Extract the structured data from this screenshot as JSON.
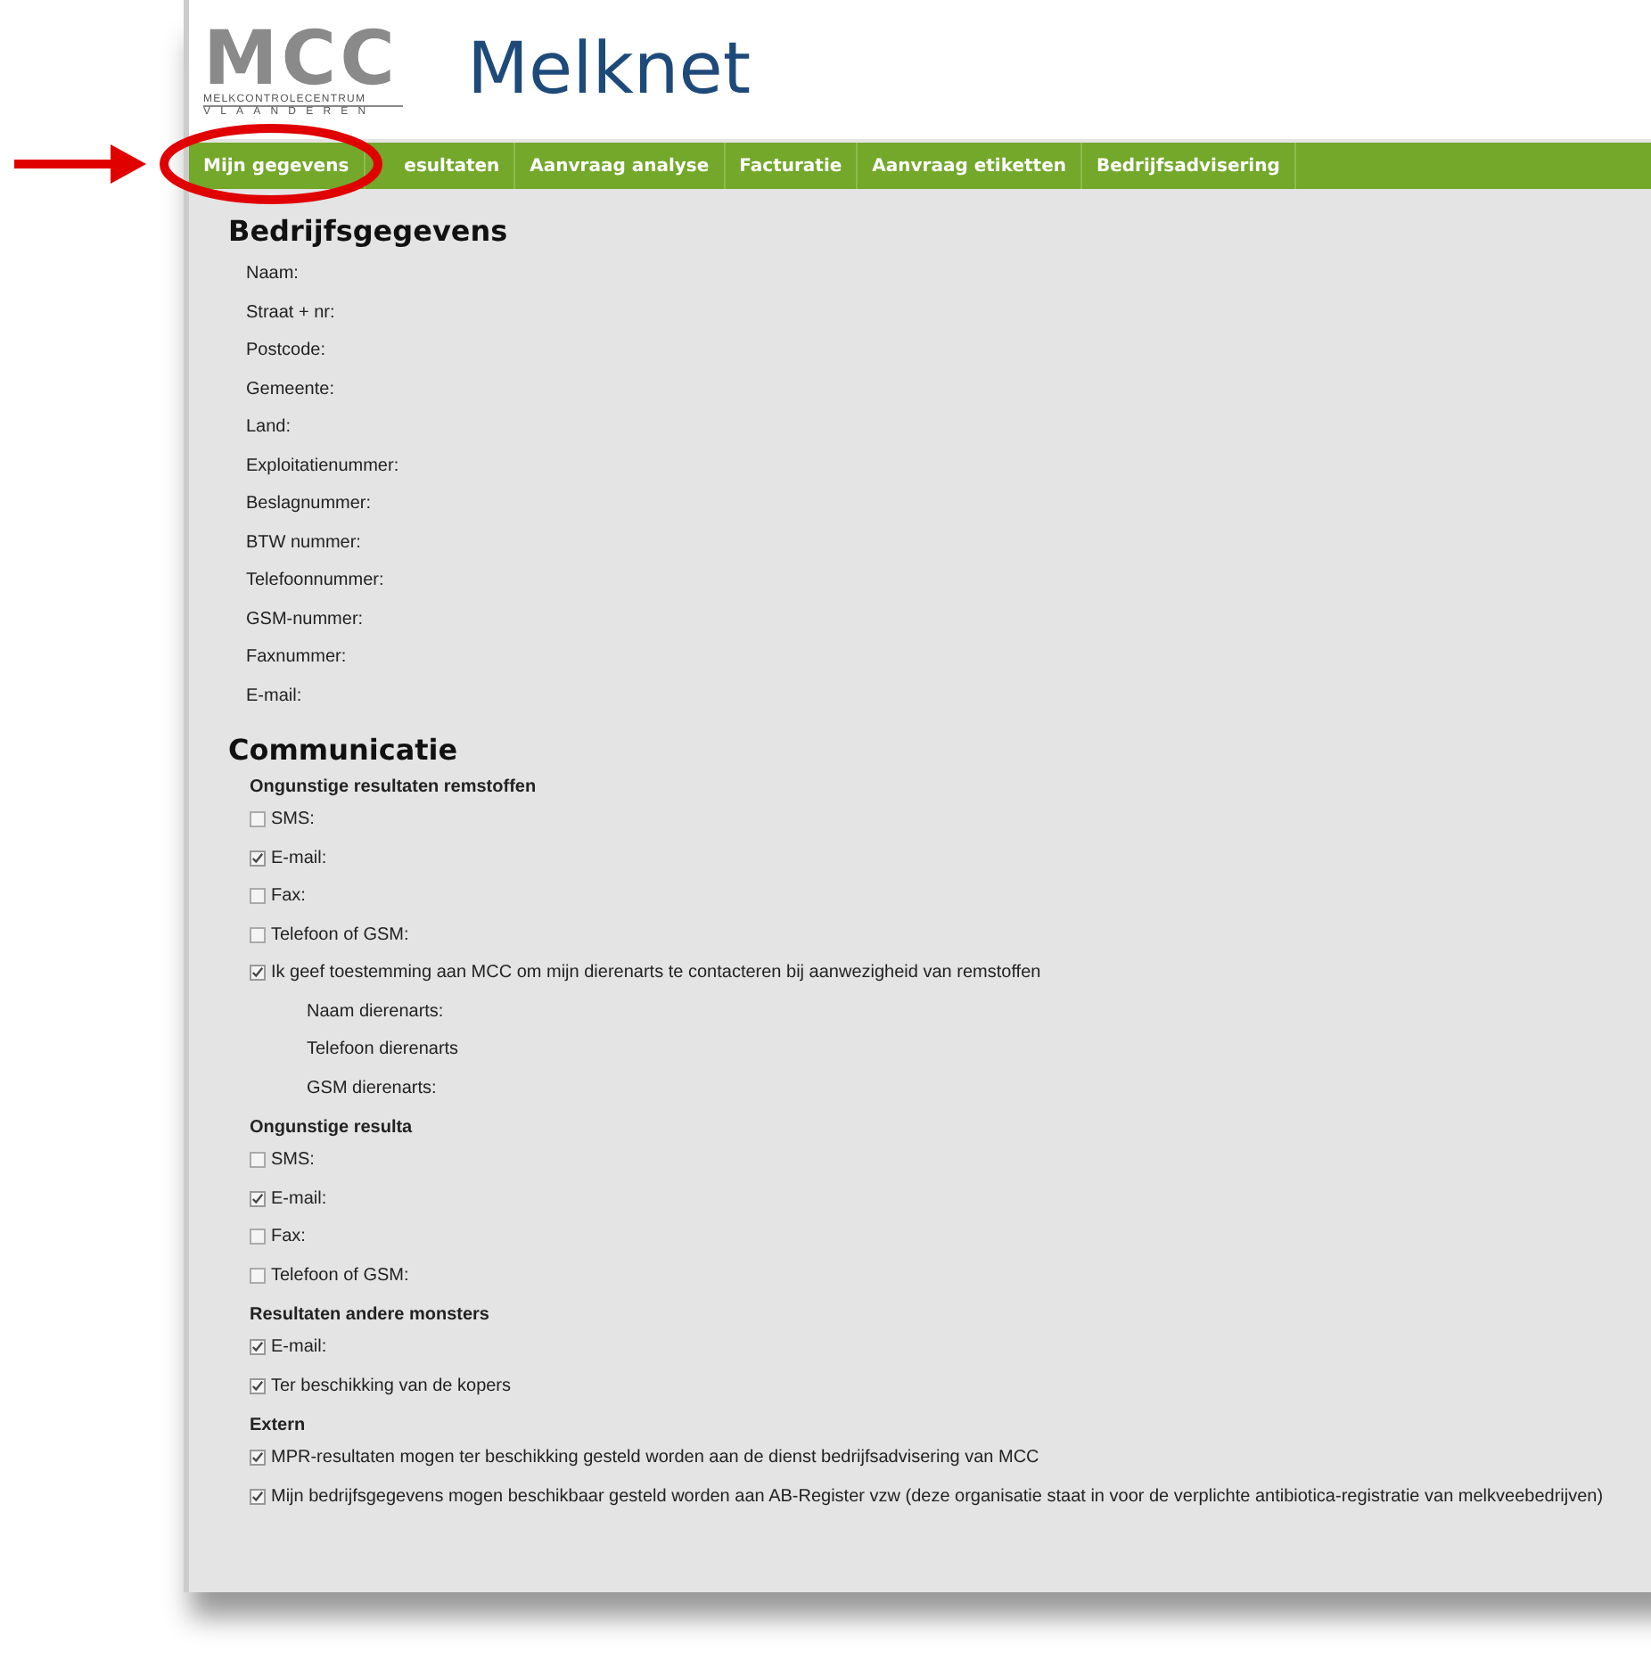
{
  "logo": {
    "mark": "MCC",
    "line_1": "MELKCONTROLECENTRUM",
    "line_2": "VLAANDEREN"
  },
  "site_title": "Melknet",
  "tabs": [
    {
      "label": "Mijn gegevens"
    },
    {
      "label": "esultaten"
    },
    {
      "label": "Aanvraag analyse"
    },
    {
      "label": "Facturatie"
    },
    {
      "label": "Aanvraag etiketten"
    },
    {
      "label": "Bedrijfsadvisering"
    }
  ],
  "company": {
    "heading": "Bedrijfsgegevens",
    "fields": [
      "Naam:",
      "Straat + nr:",
      "Postcode:",
      "Gemeente:",
      "Land:",
      "Exploitatienummer:",
      "Beslagnummer:",
      "BTW nummer:",
      "Telefoonnummer:",
      "GSM-nummer:",
      "Faxnummer:",
      "E-mail:"
    ]
  },
  "communication": {
    "heading": "Communicatie",
    "groups": [
      {
        "title": "Ongunstige resultaten remstoffen",
        "items": [
          {
            "kind": "checkbox",
            "label": "SMS:",
            "checked": false
          },
          {
            "kind": "checkbox",
            "label": "E-mail:",
            "checked": true
          },
          {
            "kind": "checkbox",
            "label": "Fax:",
            "checked": false
          },
          {
            "kind": "checkbox",
            "label": "Telefoon of GSM:",
            "checked": false
          },
          {
            "kind": "checkbox",
            "label": "Ik geef toestemming aan MCC om mijn dierenarts te contacteren bij aanwezigheid van remstoffen",
            "checked": true
          },
          {
            "kind": "field",
            "label": "Naam dierenarts:"
          },
          {
            "kind": "field",
            "label": "Telefoon dierenarts"
          },
          {
            "kind": "field",
            "label": "GSM dierenarts:"
          }
        ]
      },
      {
        "title": "Ongunstige resulta",
        "items": [
          {
            "kind": "checkbox",
            "label": "SMS:",
            "checked": false
          },
          {
            "kind": "checkbox",
            "label": "E-mail:",
            "checked": true
          },
          {
            "kind": "checkbox",
            "label": "Fax:",
            "checked": false
          },
          {
            "kind": "checkbox",
            "label": "Telefoon of GSM:",
            "checked": false
          }
        ]
      },
      {
        "title": "Resultaten andere monsters",
        "items": [
          {
            "kind": "checkbox",
            "label": "E-mail:",
            "checked": true
          },
          {
            "kind": "checkbox",
            "label": "Ter beschikking van de kopers",
            "checked": true
          }
        ]
      },
      {
        "title": "Extern",
        "items": [
          {
            "kind": "checkbox",
            "label": "MPR-resultaten mogen ter beschikking gesteld worden aan de dienst bedrijfsadvisering van MCC",
            "checked": true
          },
          {
            "kind": "checkbox",
            "label": "Mijn bedrijfsgegevens mogen beschikbaar gesteld worden aan AB-Register vzw (deze organisatie staat in voor de verplichte antibiotica-registratie van melkveebedrijven)",
            "checked": true
          }
        ]
      }
    ]
  }
}
